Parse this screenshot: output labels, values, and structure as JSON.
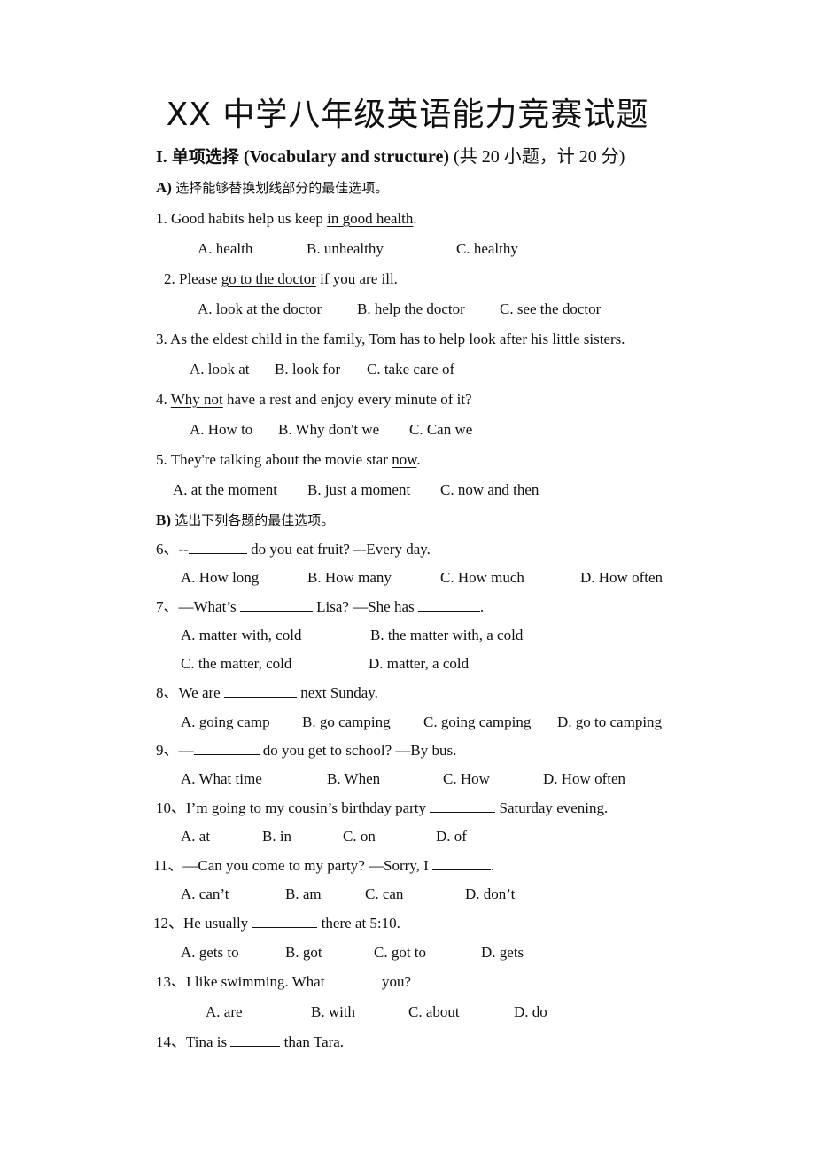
{
  "title": "XX 中学八年级英语能力竞赛试题",
  "section1": {
    "label": "I.",
    "cn_title": "单项选择",
    "en_title": "(Vocabulary and structure)",
    "note": "(共 20 小题，计 20 分)"
  },
  "partA": {
    "label": "A)",
    "instruction": "选择能够替换划线部分的最佳选项。"
  },
  "partB": {
    "label": "B)",
    "instruction": "选出下列各题的最佳选项。"
  },
  "questions": [
    {
      "pre": "1. Good habits help us keep ",
      "u": "in good health",
      "post": ".",
      "options": [
        "A. health",
        "B. unhealthy",
        "C. healthy"
      ]
    },
    {
      "pre": "2. Please ",
      "u": "go to the doctor",
      "post": " if you are ill.",
      "options": [
        "A. look at the doctor",
        "B. help the doctor",
        "C. see the doctor"
      ]
    },
    {
      "pre": "3. As the eldest child in the family, Tom has to help ",
      "u": "look after",
      "post": " his little sisters.",
      "options": [
        "A. look at",
        "B. look for",
        "C. take care of"
      ]
    },
    {
      "pre": "4. ",
      "u": "Why not",
      "post": " have a rest and enjoy every minute of it?",
      "options": [
        "A. How to",
        "B. Why don't we",
        "C. Can we"
      ]
    },
    {
      "pre": "5. They're talking about the movie star ",
      "u": "now",
      "post": ".",
      "options": [
        "A. at the moment",
        "B. just a moment",
        "C. now and then"
      ]
    },
    {
      "pre": "6、--",
      "post": "  do you eat fruit? –-Every day.",
      "options": [
        "A. How long",
        "B. How many",
        "C. How much",
        "D. How often"
      ]
    },
    {
      "pre": "7、—What’s  ",
      "mid": "  Lisa? —She has  ",
      "post": ".",
      "options": [
        "A. matter with, cold",
        "B. the matter with, a cold",
        "C. the matter, cold",
        "D. matter, a cold"
      ]
    },
    {
      "pre": "8、We are  ",
      "post": "  next Sunday.",
      "options": [
        "A. going camp",
        "B. go camping",
        "C. going camping",
        "D. go to camping"
      ]
    },
    {
      "pre": "9、—",
      "post": "  do you get to school? —By bus.",
      "options": [
        "A. What time",
        "B. When",
        "C. How",
        "D. How often"
      ]
    },
    {
      "pre": "10、I’m going to my cousin’s birthday party  ",
      "post": "  Saturday evening.",
      "options": [
        "A. at",
        "B. in",
        "C. on",
        "D. of"
      ]
    },
    {
      "pre": "11、—Can you come to my party? —Sorry, I  ",
      "post": ".",
      "options": [
        "A. can’t",
        "B. am",
        "C. can",
        "D. don’t"
      ]
    },
    {
      "pre": "12、He usually  ",
      "post": "  there at 5:10.",
      "options": [
        "A. gets to",
        "B. got",
        "C. got to",
        "D. gets"
      ]
    },
    {
      "pre": "13、I like swimming. What  ",
      "post": "  you?",
      "options": [
        "A. are",
        "B. with",
        "C. about",
        "D. do"
      ]
    },
    {
      "pre": "14、Tina is  ",
      "post": "  than Tara."
    }
  ]
}
